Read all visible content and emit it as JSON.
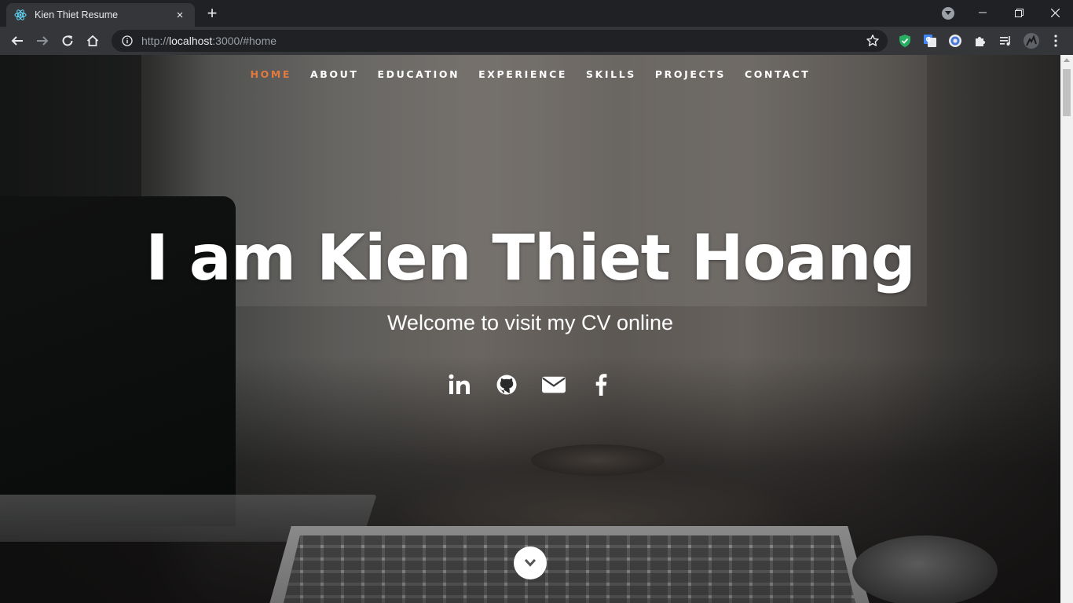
{
  "browser": {
    "tab_title": "Kien Thiet Resume",
    "tab_close": "×",
    "new_tab": "+",
    "url_scheme": "http://",
    "url_host": "localhost",
    "url_rest": ":3000/#home",
    "icons": [
      "back-icon",
      "forward-icon",
      "reload-icon",
      "home-icon",
      "info-icon",
      "star-icon",
      "shield-extension-icon",
      "translate-extension-icon",
      "chrome-extension-icon",
      "puzzle-extension-icon",
      "media-control-icon",
      "profile-avatar",
      "menu-kebab-icon"
    ]
  },
  "nav": {
    "items": [
      "HOME",
      "ABOUT",
      "EDUCATION",
      "EXPERIENCE",
      "SKILLS",
      "PROJECTS",
      "CONTACT"
    ],
    "active_color": "#e27a3f"
  },
  "hero": {
    "title": "I am Kien Thiet Hoang",
    "subtitle": "Welcome to visit my CV online",
    "social": [
      "linkedin-icon",
      "github-icon",
      "email-icon",
      "facebook-icon"
    ]
  },
  "colors": {
    "chrome_dark": "#202124",
    "chrome_toolbar": "#35363a",
    "accent": "#e27a3f"
  }
}
